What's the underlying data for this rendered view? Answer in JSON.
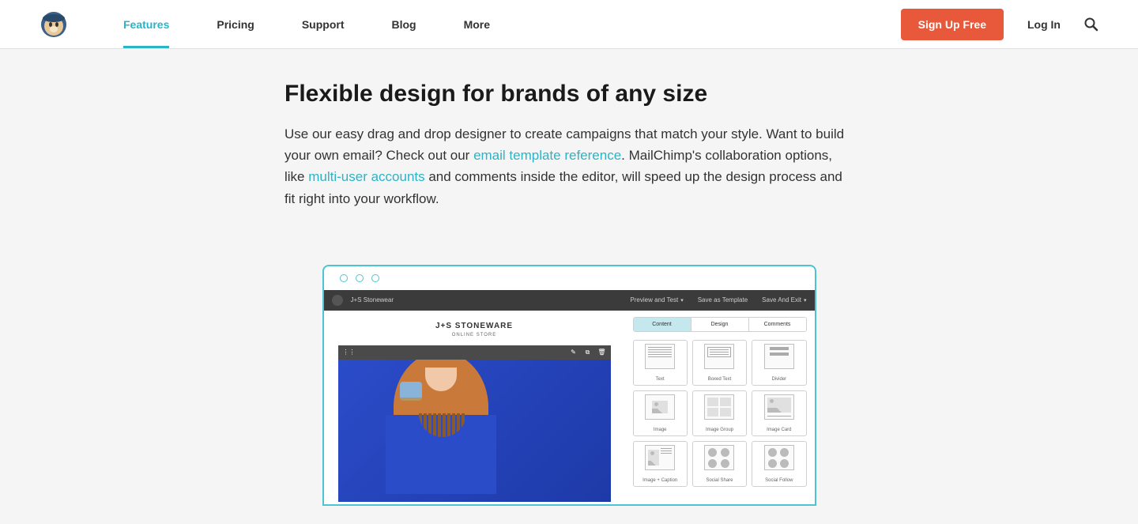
{
  "nav": {
    "items": [
      "Features",
      "Pricing",
      "Support",
      "Blog",
      "More"
    ],
    "active_index": 0
  },
  "header": {
    "signup_label": "Sign Up Free",
    "login_label": "Log In"
  },
  "content": {
    "heading": "Flexible design for brands of any size",
    "body_part1": "Use our easy drag and drop designer to create campaigns that match your style. Want to build your own email? Check out our ",
    "link1": "email template reference",
    "body_part2": ". MailChimp's collaboration options, like ",
    "link2": "multi-user accounts",
    "body_part3": " and comments inside the editor, will speed up the design process and fit right into your workflow."
  },
  "mock": {
    "topbar": {
      "brand": "J+S Stonewear",
      "links": [
        "Preview and Test",
        "Save as Template",
        "Save And Exit"
      ]
    },
    "store": {
      "name": "J+S STONEWARE",
      "sub": "ONLINE STORE"
    },
    "tabs": [
      "Content",
      "Design",
      "Comments"
    ],
    "tabs_active_index": 0,
    "blocks": [
      "Text",
      "Boxed Text",
      "Divider",
      "Image",
      "Image Group",
      "Image Card",
      "Image + Caption",
      "Social Share",
      "Social Follow"
    ]
  }
}
